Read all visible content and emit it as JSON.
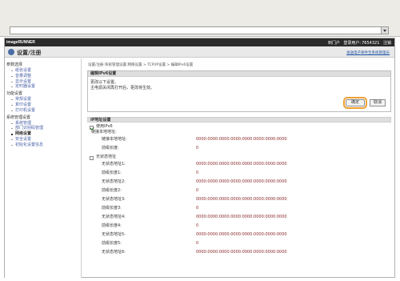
{
  "header": {
    "brand": "imageRUNNER",
    "portal": "到门户",
    "login_user_label": "登录用户:",
    "login_user": "7654321",
    "logout": "注销"
  },
  "titlebar": {
    "title": "设置/注册",
    "link": "发送电子邮件至系统管理员"
  },
  "sidebar": {
    "groups": [
      {
        "heading": "参数选择",
        "items": [
          "纸张设置",
          "音量调整",
          "显示设置",
          "定时器设置"
        ]
      },
      {
        "heading": "功能设置",
        "items": [
          "常规设置",
          "复印设置",
          "打印机设置"
        ]
      },
      {
        "heading": "系统管理设置",
        "items": [
          "系统管理",
          "部门识别码管理",
          "网络设置",
          "安全设置",
          "初始化设置信息"
        ]
      }
    ],
    "active": "网络设置"
  },
  "breadcrumb": "设置/注册:系统管理设置:网络设置 > TCP/IP设置 > 编辑IPv6设置",
  "panel": {
    "title": "编辑IPv6设置",
    "line1": "更改以下设置。",
    "line2": "主电源关闭再打开后，更改将生效。",
    "ok": "确定",
    "cancel": "取消"
  },
  "ip_section": {
    "title": "IP地址设置",
    "use_ipv6": "使用IPv6",
    "link_local_label": "链接本地地址:",
    "rows1": [
      {
        "key": "链接本地地址:",
        "value": "0000:0000:0000:0000:0000:0000:0000:0000"
      },
      {
        "key": "前缀长度:",
        "value": "0"
      }
    ],
    "stateless_label": "无状态地址",
    "rows2": [
      {
        "key": "无状态地址1:",
        "value": "0000:0000:0000:0000:0000:0000:0000:0000"
      },
      {
        "key": "前缀长度1:",
        "value": "0"
      },
      {
        "key": "无状态地址2:",
        "value": "0000:0000:0000:0000:0000:0000:0000:0000"
      },
      {
        "key": "前缀长度2:",
        "value": "0"
      },
      {
        "key": "无状态地址3:",
        "value": "0000:0000:0000:0000:0000:0000:0000:0000"
      },
      {
        "key": "前缀长度3:",
        "value": "0"
      },
      {
        "key": "无状态地址4:",
        "value": "0000:0000:0000:0000:0000:0000:0000:0000"
      },
      {
        "key": "前缀长度4:",
        "value": "0"
      },
      {
        "key": "无状态地址5:",
        "value": "0000:0000:0000:0000:0000:0000:0000:0000"
      },
      {
        "key": "前缀长度5:",
        "value": "0"
      },
      {
        "key": "无状态地址6:",
        "value": "0000:0000:0000:0000:0000:0000:0000:0000"
      }
    ]
  },
  "colors": {
    "accent": "#f0a030",
    "link": "#2155a6",
    "value": "#8a2a2a",
    "topbar": "#2b2b2b"
  }
}
